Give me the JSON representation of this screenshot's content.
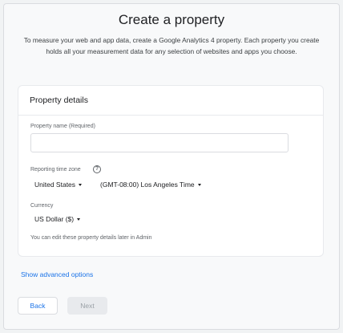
{
  "header": {
    "title": "Create a property",
    "description": "To measure your web and app data, create a Google Analytics 4 property. Each property you create holds all your measurement data for any selection of websites and apps you choose."
  },
  "card": {
    "title": "Property details",
    "name_label": "Property name (Required)",
    "name_value": "",
    "timezone_label": "Reporting time zone",
    "country": "United States",
    "timezone": "(GMT-08:00) Los Angeles Time",
    "currency_label": "Currency",
    "currency": "US Dollar ($)",
    "note": "You can edit these property details later in Admin"
  },
  "advanced_link": "Show advanced options",
  "buttons": {
    "back": "Back",
    "next": "Next"
  },
  "icons": {
    "help": "help-circle-icon",
    "dropdown": "caret-down-icon"
  },
  "colors": {
    "accent": "#1a73e8",
    "disabled_bg": "#e8eaed",
    "disabled_text": "#9aa0a6"
  }
}
